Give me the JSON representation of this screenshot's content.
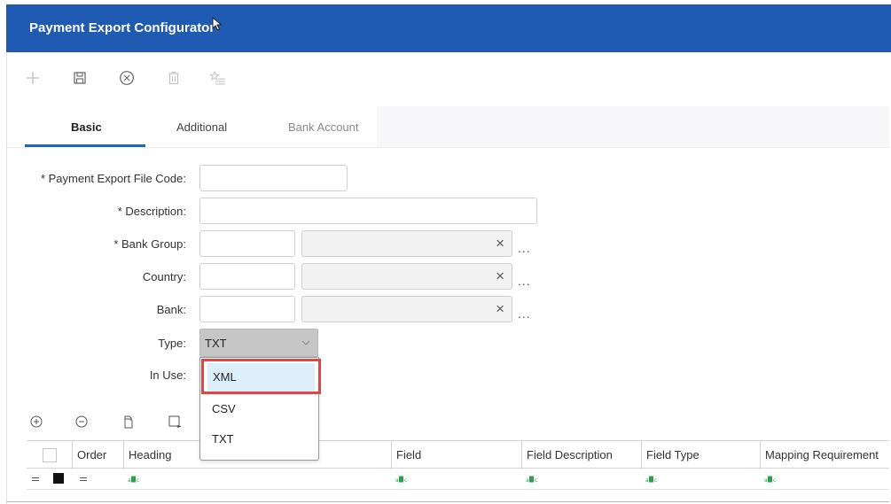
{
  "window": {
    "title": "Payment Export Configurator"
  },
  "toolbar": {
    "add_icon": "plus-icon",
    "save_icon": "save-icon",
    "cancel_icon": "cancel-circle-icon",
    "delete_icon": "trash-icon",
    "favorite_icon": "star-list-icon"
  },
  "tabs": [
    {
      "label": "Basic",
      "state": "active"
    },
    {
      "label": "Additional",
      "state": "normal"
    },
    {
      "label": "Bank Account",
      "state": "disabled"
    }
  ],
  "form": {
    "code_label": "* Payment Export File Code:",
    "code_value": "",
    "description_label": "* Description:",
    "description_value": "",
    "bank_group_label": "* Bank Group:",
    "country_label": "Country:",
    "bank_label": "Bank:",
    "type_label": "Type:",
    "type_value": "TXT",
    "in_use_label": "In Use:",
    "clear_glyph": "×",
    "lookup_glyph": "..."
  },
  "type_options": [
    "XML",
    "CSV",
    "TXT"
  ],
  "grid": {
    "columns": [
      "Order",
      "Heading",
      "Field",
      "Field Description",
      "Field Type",
      "Mapping Requirement"
    ],
    "row_icon": "abc-text-icon"
  },
  "colors": {
    "header_blue": "#1f5bb3",
    "tab_underline": "#1f66c1",
    "highlight_red": "#e04444",
    "option_selected_bg": "#ddeefb"
  }
}
